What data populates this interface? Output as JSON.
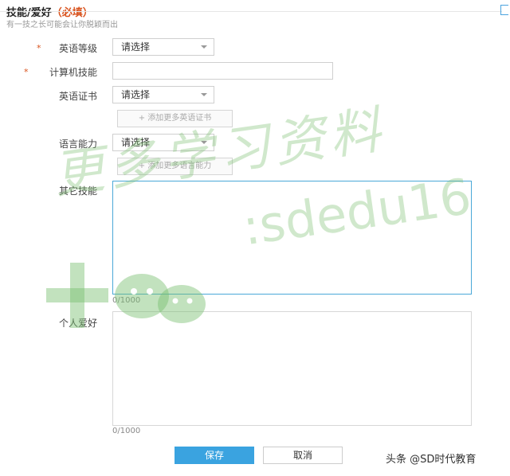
{
  "header": {
    "title": "技能/爱好",
    "required_mark": "（必填）",
    "subtitle": "有一技之长可能会让你脱颖而出"
  },
  "fields": {
    "english_level": {
      "label": "英语等级",
      "value": "请选择"
    },
    "computer_skill": {
      "label": "计算机技能",
      "value": ""
    },
    "english_cert": {
      "label": "英语证书",
      "value": "请选择",
      "add_label": "+ 添加更多英语证书"
    },
    "language": {
      "label": "语言能力",
      "value": "请选择",
      "add_label": "+ 添加更多语言能力"
    },
    "other_skills": {
      "label": "其它技能",
      "counter": "0/1000"
    },
    "hobbies": {
      "label": "个人爱好",
      "counter": "0/1000"
    }
  },
  "required_star": "*",
  "actions": {
    "save": "保存",
    "cancel": "取消"
  },
  "watermark": {
    "line1": "更多学习资料",
    "line2": ":sdedu16"
  },
  "credit": "头条 @SD时代教育",
  "colors": {
    "accent": "#3aa3e0",
    "required": "#d9531e",
    "watermark": "#78be6e"
  }
}
